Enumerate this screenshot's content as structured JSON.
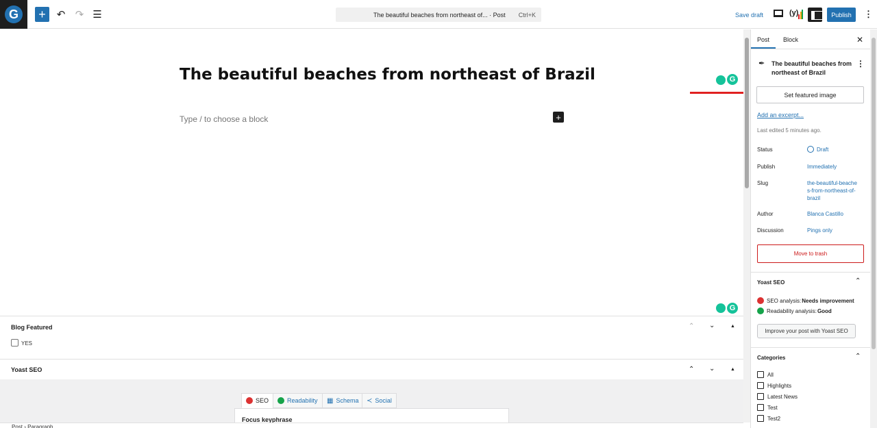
{
  "topbar": {
    "logo_letter": "G",
    "add_block_icon": "+",
    "undo_icon": "↶",
    "redo_icon": "↷",
    "list_view_icon": "☰",
    "command": {
      "title": "The beautiful beaches from northeast of... · Post",
      "shortcut": "Ctrl+K"
    },
    "save_draft": "Save draft",
    "yoast_icon": "(y)",
    "publish": "Publish",
    "more_icon": "⋮"
  },
  "editor": {
    "title": "The beautiful beaches from northeast of Brazil",
    "block_placeholder": "Type / to choose a block",
    "add_block_icon": "+",
    "grammarly_letter": "G"
  },
  "metaboxes": {
    "blog_featured": {
      "title": "Blog Featured",
      "checkbox_label": "YES"
    },
    "yoast": {
      "title": "Yoast SEO",
      "tabs": [
        {
          "label": "SEO"
        },
        {
          "label": "Readability"
        },
        {
          "label": "Schema"
        },
        {
          "label": "Social"
        }
      ],
      "focus_keyphrase": "Focus keyphrase"
    },
    "up_icon": "⌃",
    "down_icon": "⌄",
    "toggle_icon": "▲"
  },
  "breadcrumb": "Post  ›  Paragraph",
  "sidebar": {
    "tabs": {
      "post": "Post",
      "block": "Block"
    },
    "close_icon": "✕",
    "post_card": {
      "title": "The beautiful beaches from northeast of Brazil"
    },
    "set_featured_image": "Set featured image",
    "add_excerpt": "Add an excerpt...",
    "last_edited": "Last edited 5 minutes ago.",
    "rows": [
      {
        "label": "Status",
        "value": "Draft"
      },
      {
        "label": "Publish",
        "value": "Immediately"
      },
      {
        "label": "Slug",
        "value": "the-beautiful-beaches-from-northeast-of-brazil"
      },
      {
        "label": "Author",
        "value": "Blanca Castillo"
      },
      {
        "label": "Discussion",
        "value": "Pings only"
      }
    ],
    "move_to_trash": "Move to trash",
    "yoast": {
      "title": "Yoast SEO",
      "seo_analysis_label": "SEO analysis: ",
      "seo_analysis_value": "Needs improvement",
      "readability_label": "Readability analysis: ",
      "readability_value": "Good",
      "improve_button": "Improve your post with Yoast SEO"
    },
    "categories": {
      "title": "Categories",
      "items": [
        "All",
        "Highlights",
        "Latest News",
        "Test",
        "Test2"
      ]
    },
    "chevron_up_icon": "⌃"
  },
  "colors": {
    "accent": "#2271b1",
    "danger": "#cc1818",
    "arrow": "#e02020",
    "grammarly": "#15c39a"
  }
}
